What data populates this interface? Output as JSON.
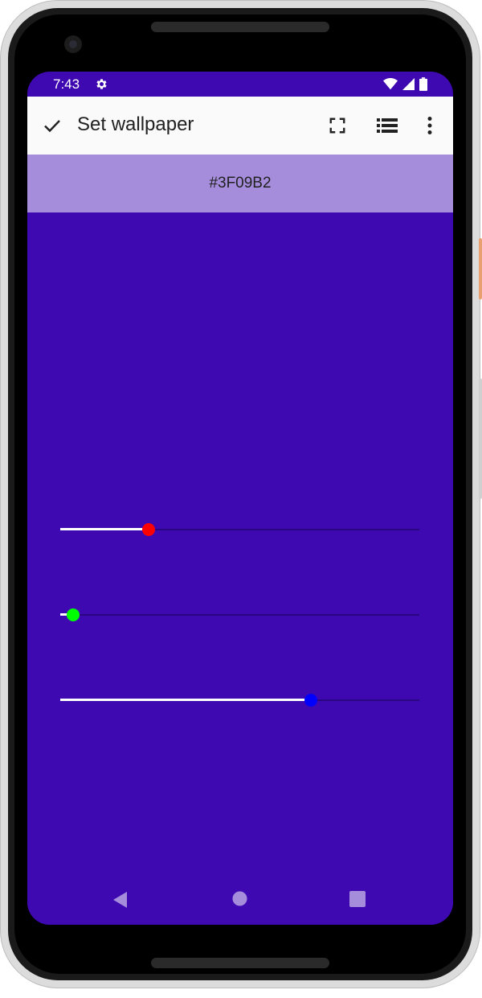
{
  "status": {
    "time": "7:43",
    "icons": [
      "gear-icon",
      "wifi-icon",
      "signal-icon",
      "battery-icon"
    ]
  },
  "toolbar": {
    "title": "Set wallpaper",
    "icons": [
      "check-icon",
      "fullscreen-icon",
      "list-icon",
      "more-vert-icon"
    ]
  },
  "color": {
    "hex": "#3F09B2",
    "background": "#3F09B2",
    "accent_light": "#A58DDB"
  },
  "sliders": [
    {
      "name": "red",
      "value": 63,
      "max": 255,
      "thumb_color": "#FF0000"
    },
    {
      "name": "green",
      "value": 9,
      "max": 255,
      "thumb_color": "#00FF00"
    },
    {
      "name": "blue",
      "value": 178,
      "max": 255,
      "thumb_color": "#0000FF"
    }
  ],
  "navigation": [
    "back-icon",
    "home-icon",
    "recents-icon"
  ]
}
